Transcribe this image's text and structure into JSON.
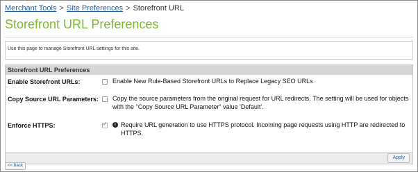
{
  "breadcrumb": {
    "items": [
      "Merchant Tools",
      "Site Preferences",
      "Storefront URL"
    ],
    "separator": ">"
  },
  "page_title": "Storefront URL Preferences",
  "intro_text": "Use this page to manage Storefront URL settings for this site.",
  "panel": {
    "title": "Storefront URL Preferences",
    "rows": [
      {
        "label": "Enable Storefront URLs:",
        "checked": false,
        "has_info_icon": false,
        "description": "Enable New Rule-Based Storefront URLs to Replace Legacy SEO URLs"
      },
      {
        "label": "Copy Source URL Parameters:",
        "checked": false,
        "has_info_icon": false,
        "description": "Copy the source parameters from the original request for URL redirects. The setting will be used for objects with the \"Copy Source URL Parameter\" value 'Default'."
      },
      {
        "label": "Enforce HTTPS:",
        "checked": true,
        "has_info_icon": true,
        "description": "Require URL generation to use HTTPS protocol. Incoming page requests using HTTP are redirected to HTTPS."
      }
    ],
    "apply_label": "Apply"
  },
  "back_label": "<< Back",
  "colors": {
    "title_green": "#7cb82f",
    "link_blue": "#1f5fa8",
    "header_gray": "#d6d6d6"
  },
  "icons": {
    "info": "info-icon",
    "checkbox": "checkbox-icon"
  }
}
